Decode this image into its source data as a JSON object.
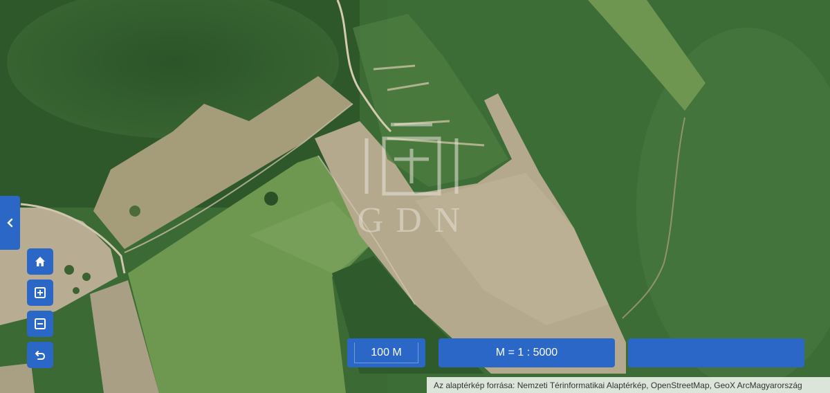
{
  "map": {
    "basemap": "satellite",
    "watermark_text": "GDN",
    "colors": {
      "accent": "#2b67c6",
      "forest": "#2f5a2c",
      "field_light": "#b9ac90",
      "field_green": "#6f9a4f"
    }
  },
  "controls": {
    "sidebar_toggle_icon": "chevron-left-icon",
    "buttons": [
      {
        "icon": "home-icon"
      },
      {
        "icon": "zoom-in-icon"
      },
      {
        "icon": "zoom-out-icon"
      },
      {
        "icon": "back-icon"
      }
    ]
  },
  "footer": {
    "scale_label": "100 M",
    "ratio_label": "M = 1 : 5000",
    "empty_panel": "",
    "attribution": "Az alaptérkép forrása: Nemzeti Térinformatikai Alaptérkép, OpenStreetMap, GeoX ArcMagyarország"
  }
}
